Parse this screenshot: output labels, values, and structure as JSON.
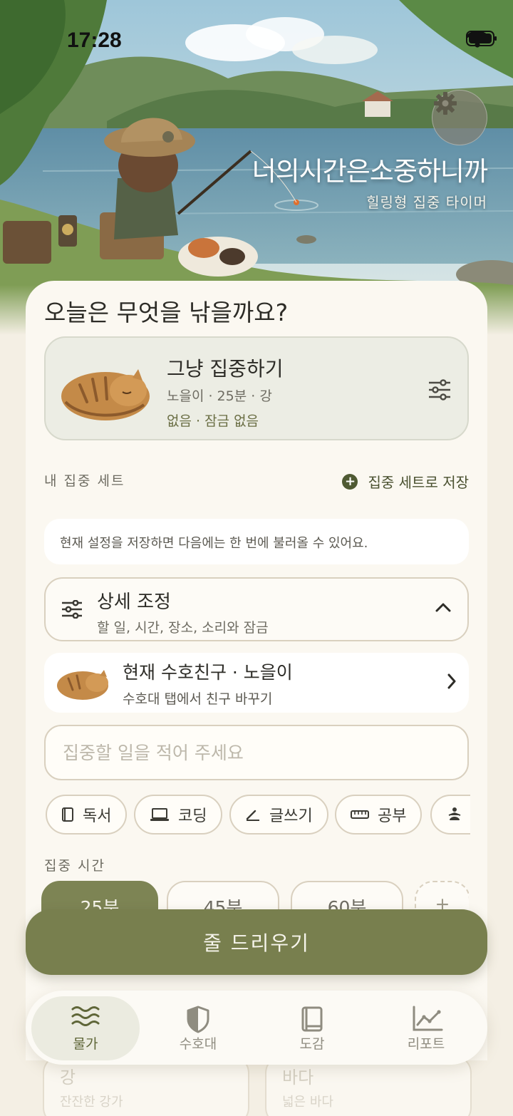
{
  "status_bar": {
    "time": "17:28"
  },
  "hero": {
    "title": "너의시간은소중하니까",
    "subtitle": "힐링형 집중 타이머"
  },
  "main": {
    "heading": "오늘은 무엇을 낚을까요?",
    "preset": {
      "title": "그냥 집중하기",
      "meta_line1": "노을이 · 25분 · 강",
      "meta_line2": "없음 · 잠금 없음"
    },
    "my_sets_label": "내 집중 세트",
    "save_set_label": "집중 세트로 저장",
    "hint": "현재 설정을 저장하면 다음에는 한 번에 불러올 수 있어요.",
    "detail": {
      "title": "상세 조정",
      "subtitle": "할 일, 시간, 장소, 소리와 잠금"
    },
    "guardian": {
      "title": "현재 수호친구 · 노을이",
      "subtitle": "수호대 탭에서 친구 바꾸기"
    },
    "task_input": {
      "placeholder": "집중할 일을 적어 주세요",
      "value": ""
    },
    "chips": [
      {
        "label": "독서",
        "icon": "book-icon"
      },
      {
        "label": "코딩",
        "icon": "laptop-icon"
      },
      {
        "label": "글쓰기",
        "icon": "pencil-icon"
      },
      {
        "label": "공부",
        "icon": "ruler-icon"
      },
      {
        "label": "",
        "icon": "meditation-icon"
      }
    ],
    "duration_label": "집중 시간",
    "durations": [
      {
        "label": "25분",
        "active": true
      },
      {
        "label": "45분",
        "active": false
      },
      {
        "label": "60분",
        "active": false
      },
      {
        "label": "+",
        "active": false
      }
    ],
    "background_cards": [
      {
        "title": "강",
        "subtitle": "잔잔한 강가"
      },
      {
        "title": "바다",
        "subtitle": "넓은 바다"
      }
    ]
  },
  "cast_button": "줄 드리우기",
  "tabbar": {
    "items": [
      {
        "label": "물가",
        "icon": "waves-icon",
        "active": true
      },
      {
        "label": "수호대",
        "icon": "shield-icon",
        "active": false
      },
      {
        "label": "도감",
        "icon": "book-icon",
        "active": false
      },
      {
        "label": "리포트",
        "icon": "chart-icon",
        "active": false
      }
    ]
  },
  "colors": {
    "accent": "#787f4e",
    "sheet": "#fbf8f1",
    "background": "#f4efe4",
    "text": "#2d2c27"
  }
}
